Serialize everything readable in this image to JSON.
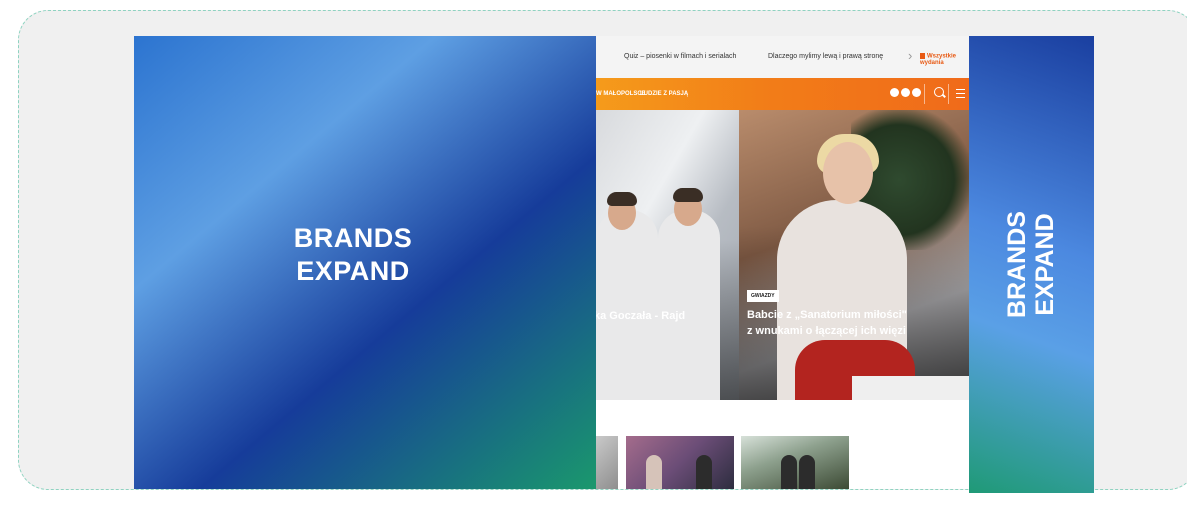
{
  "ads": {
    "left": {
      "line1": "BRANDS",
      "line2": "EXPAND"
    },
    "right": {
      "line1": "BRANDS",
      "line2": "EXPAND"
    }
  },
  "site": {
    "topbar": {
      "link1": "Quiz – piosenki w filmach i serialach",
      "link2": "Dlaczego mylimy lewą i prawą stronę",
      "editions": "Wszystkie wydania"
    },
    "nav": {
      "item1": "W MAŁOPOLSCE",
      "item2": "LUDZIE Z PASJĄ"
    },
    "hero": {
      "left_title": "ka Goczała - Rajd",
      "right_tag": "GWIAZDY",
      "right_title": "Babcie z „Sanatorium miłości\" z wnukami o łączącej ich więzi"
    }
  },
  "colors": {
    "nav_orange": "#f27d18",
    "ad_blue": "#1a3fa0",
    "ad_green": "#1f9a76",
    "frame_bg": "#f0f0f0"
  }
}
